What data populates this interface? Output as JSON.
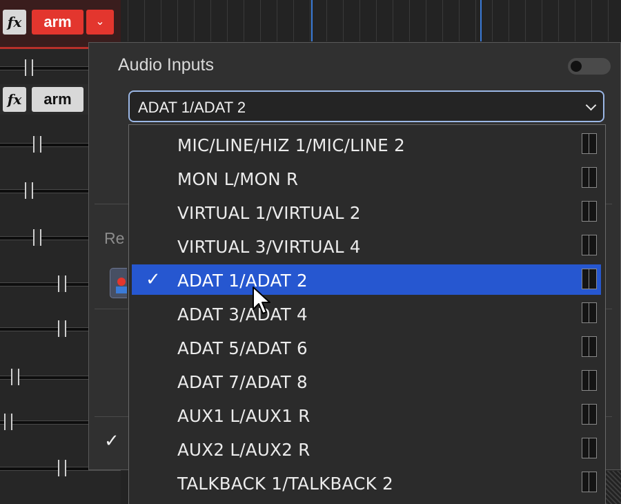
{
  "tracks": {
    "fx_label": "fx",
    "arm_label": "arm",
    "armed_color": "#e3362e"
  },
  "audio_inputs": {
    "title": "Audio Inputs",
    "toggle_on": false,
    "selected_value": "ADAT 1/ADAT 2",
    "section_label_partial": "Re",
    "check_glyph": "✓",
    "options": [
      {
        "label": "MIC/LINE/HIZ 1/MIC/LINE 2",
        "selected": false
      },
      {
        "label": "MON L/MON R",
        "selected": false
      },
      {
        "label": "VIRTUAL 1/VIRTUAL 2",
        "selected": false
      },
      {
        "label": "VIRTUAL 3/VIRTUAL 4",
        "selected": false
      },
      {
        "label": "ADAT 1/ADAT 2",
        "selected": true
      },
      {
        "label": "ADAT 3/ADAT 4",
        "selected": false
      },
      {
        "label": "ADAT 5/ADAT 6",
        "selected": false
      },
      {
        "label": "ADAT 7/ADAT 8",
        "selected": false
      },
      {
        "label": "AUX1 L/AUX1 R",
        "selected": false
      },
      {
        "label": "AUX2 L/AUX2 R",
        "selected": false
      },
      {
        "label": "TALKBACK 1/TALKBACK 2",
        "selected": false
      }
    ],
    "highlight_color": "#2657d0"
  },
  "icons": {
    "chevron": "chevron-down-icon",
    "meter": "stereo-meter-icon",
    "cursor": "mouse-pointer-icon"
  }
}
